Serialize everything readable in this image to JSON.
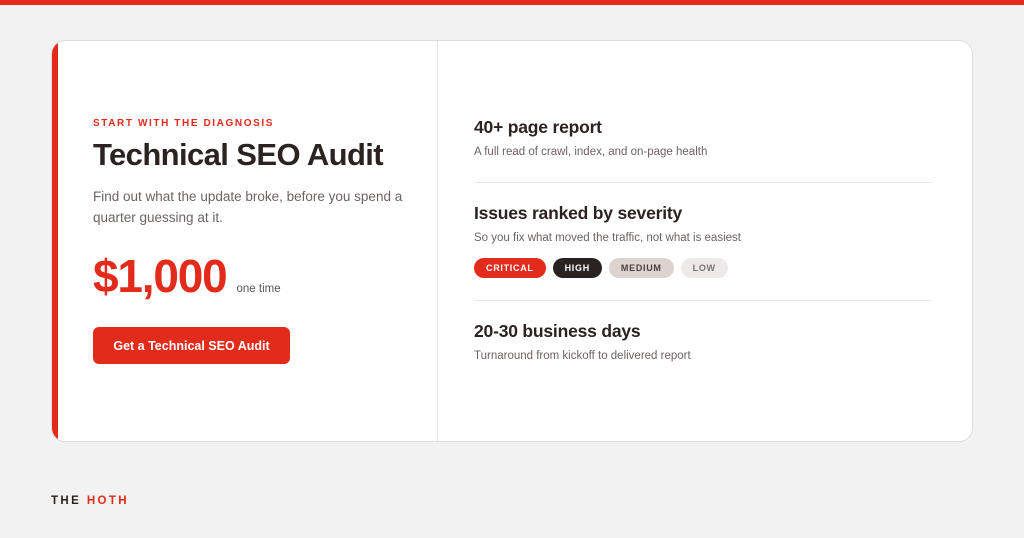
{
  "colors": {
    "accent": "#e32b1c",
    "dark": "#2b2321",
    "background": "#f2f2f2",
    "card": "#ffffff"
  },
  "offer": {
    "eyebrow": "START WITH THE DIAGNOSIS",
    "title": "Technical SEO Audit",
    "description": "Find out what the update broke, before you spend a quarter guessing at it.",
    "price": "$1,000",
    "price_note": "one time",
    "cta_label": "Get a Technical SEO Audit"
  },
  "features": [
    {
      "title": "40+ page report",
      "subtitle": "A full read of crawl, index, and on-page health"
    },
    {
      "title": "Issues ranked by severity",
      "subtitle": "So you fix what moved the traffic, not what is easiest",
      "tags": [
        "CRITICAL",
        "HIGH",
        "MEDIUM",
        "LOW"
      ]
    },
    {
      "title": "20-30 business days",
      "subtitle": "Turnaround from kickoff to delivered report"
    }
  ],
  "footer": {
    "logo_part1": "THE",
    "logo_part2": "HOTH"
  }
}
